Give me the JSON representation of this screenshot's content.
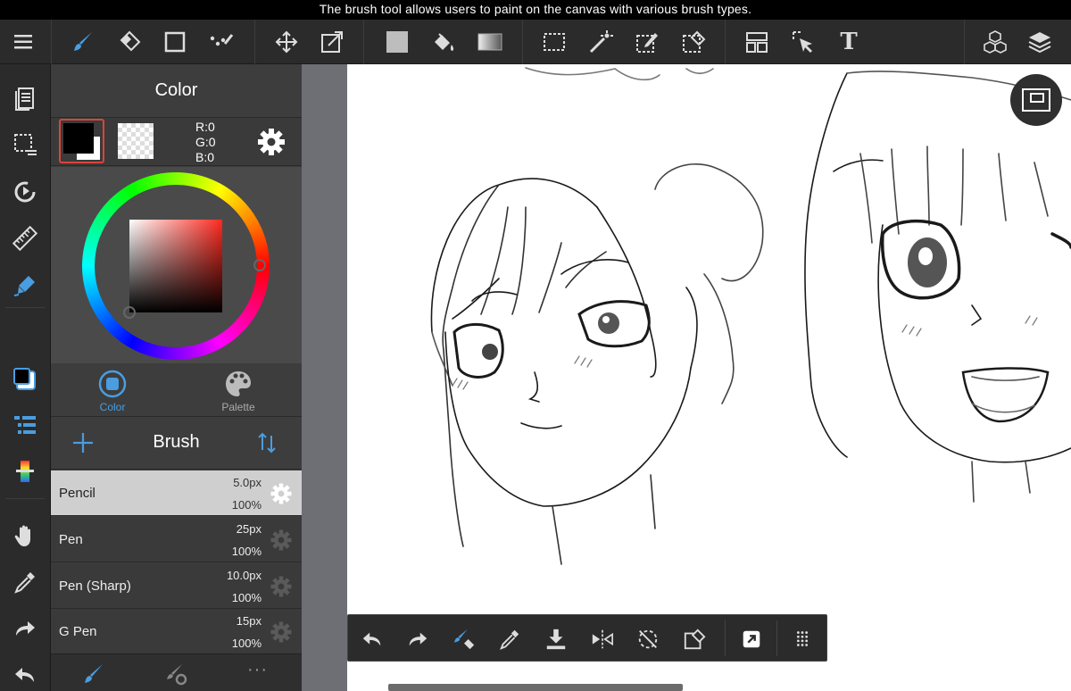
{
  "caption": "The brush tool allows users to paint on the canvas with various brush types.",
  "colors": {
    "accent": "#4a9de0",
    "toolbar": "#2b2b2b",
    "panel": "#3d3d3d",
    "selected_row": "#cfcfcf",
    "canvas_gutter": "#6d6f74"
  },
  "toolbar": {
    "items": [
      "menu-icon",
      "brush-icon",
      "eraser-icon",
      "rectangle-shape-icon",
      "dotted-line-icon",
      "move-icon",
      "transform-icon",
      "fill-color-swatch",
      "bucket-icon",
      "gradient-icon",
      "select-rect-icon",
      "magic-wand-icon",
      "select-pen-icon",
      "select-eraser-icon",
      "layout-icon",
      "select-arrow-icon",
      "text-icon",
      "3d-cubes-icon",
      "layers-icon"
    ],
    "text_tool": "T"
  },
  "sidebar": {
    "items": [
      "pages-icon",
      "selection-icon",
      "rotate-icon",
      "ruler-icon",
      "brush-pen-icon",
      "color-swatch-icon",
      "list-icon",
      "gradient-bar-icon",
      "hand-icon",
      "eyedropper-icon",
      "redo-icon",
      "undo-icon"
    ]
  },
  "color_panel": {
    "title": "Color",
    "rgb": {
      "r": "R:0",
      "g": "G:0",
      "b": "B:0"
    },
    "foreground": "#000000",
    "background": "#ffffff",
    "tabs": [
      {
        "label": "Color",
        "active": true
      },
      {
        "label": "Palette",
        "active": false
      }
    ]
  },
  "brush_panel": {
    "title": "Brush",
    "brushes": [
      {
        "name": "Pencil",
        "size": "5.0px",
        "opacity": "100%",
        "selected": true
      },
      {
        "name": "Pen",
        "size": "25px",
        "opacity": "100%",
        "selected": false
      },
      {
        "name": "Pen (Sharp)",
        "size": "10.0px",
        "opacity": "100%",
        "selected": false
      },
      {
        "name": "G Pen",
        "size": "15px",
        "opacity": "100%",
        "selected": false
      }
    ],
    "footer_more": "···"
  },
  "floating_toolbar": {
    "items": [
      "undo-icon",
      "redo-icon",
      "brush-eraser-toggle-icon",
      "eyedropper-icon",
      "save-download-icon",
      "flip-horizontal-icon",
      "rotate-off-icon",
      "clear-selection-icon",
      "snap-icon",
      "grid-menu-icon"
    ]
  }
}
